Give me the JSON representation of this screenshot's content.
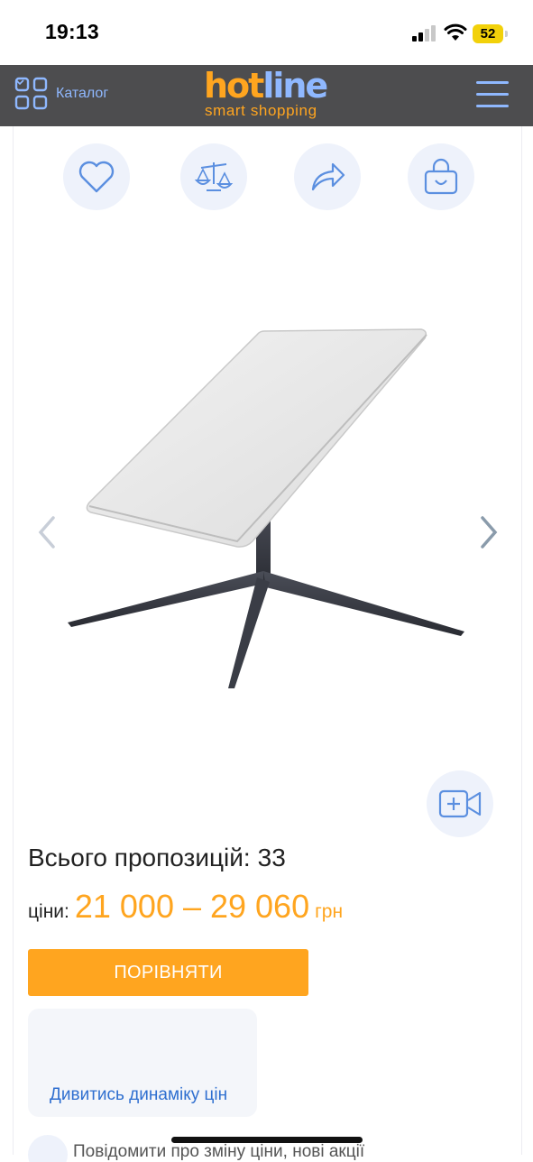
{
  "status_bar": {
    "time": "19:13",
    "battery": "52"
  },
  "header": {
    "catalog_label": "Каталог",
    "logo_hot": "hot",
    "logo_line": "line",
    "logo_tagline": "smart shopping"
  },
  "actions": [
    {
      "icon": "heart-icon"
    },
    {
      "icon": "scales-icon"
    },
    {
      "icon": "share-icon"
    },
    {
      "icon": "shopping-bag-icon"
    }
  ],
  "gallery": {
    "image": "satellite-dish-product",
    "prev_icon": "chevron-left-icon",
    "next_icon": "chevron-right-icon",
    "video_icon": "add-video-icon"
  },
  "offers": {
    "label": "Всього пропозицій:",
    "count": "33"
  },
  "prices": {
    "label": "ціни:",
    "range": "21 000 – 29 060",
    "currency": "грн"
  },
  "compare_button": "ПОРІВНЯТИ",
  "price_dynamics_link": "Дивитись динаміку цін",
  "notify_text": "Повідомити про зміну ціни, нові акції",
  "colors": {
    "accent": "#ffa51f",
    "link": "#2f6fd0",
    "header_bg": "#4d4d4f",
    "icon_blue": "#8fb8ff"
  }
}
